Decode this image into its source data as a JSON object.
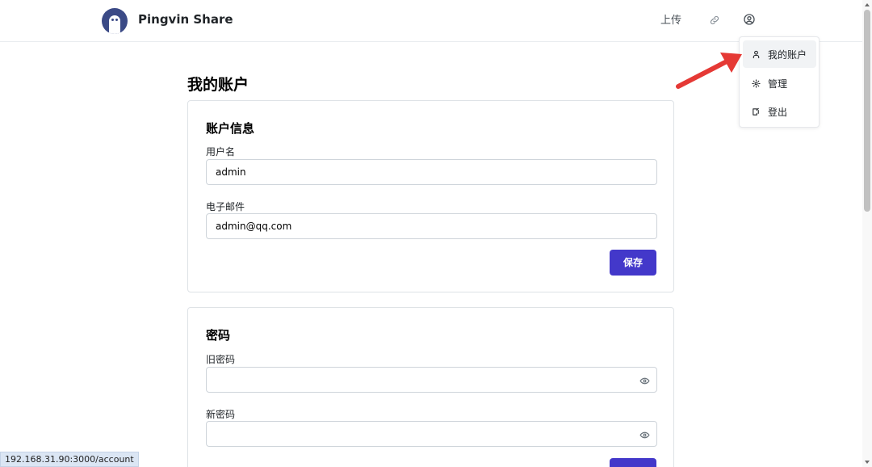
{
  "header": {
    "app_title": "Pingvin Share",
    "upload_label": "上传",
    "link_icon": "link-icon",
    "avatar_icon": "user-circle-icon"
  },
  "dropdown": {
    "items": [
      {
        "label": "我的账户",
        "icon": "user-icon"
      },
      {
        "label": "管理",
        "icon": "gear-icon"
      },
      {
        "label": "登出",
        "icon": "logout-icon"
      }
    ]
  },
  "page": {
    "title": "我的账户"
  },
  "account_card": {
    "title": "账户信息",
    "username_label": "用户名",
    "username_value": "admin",
    "email_label": "电子邮件",
    "email_value": "admin@qq.com",
    "save_label": "保存"
  },
  "password_card": {
    "title": "密码",
    "old_password_label": "旧密码",
    "new_password_label": "新密码"
  },
  "status_bar": {
    "url": "192.168.31.90:3000/account"
  },
  "colors": {
    "primary": "#4338ca",
    "annotation_arrow": "#e53935",
    "logo": "#3b4a86"
  }
}
